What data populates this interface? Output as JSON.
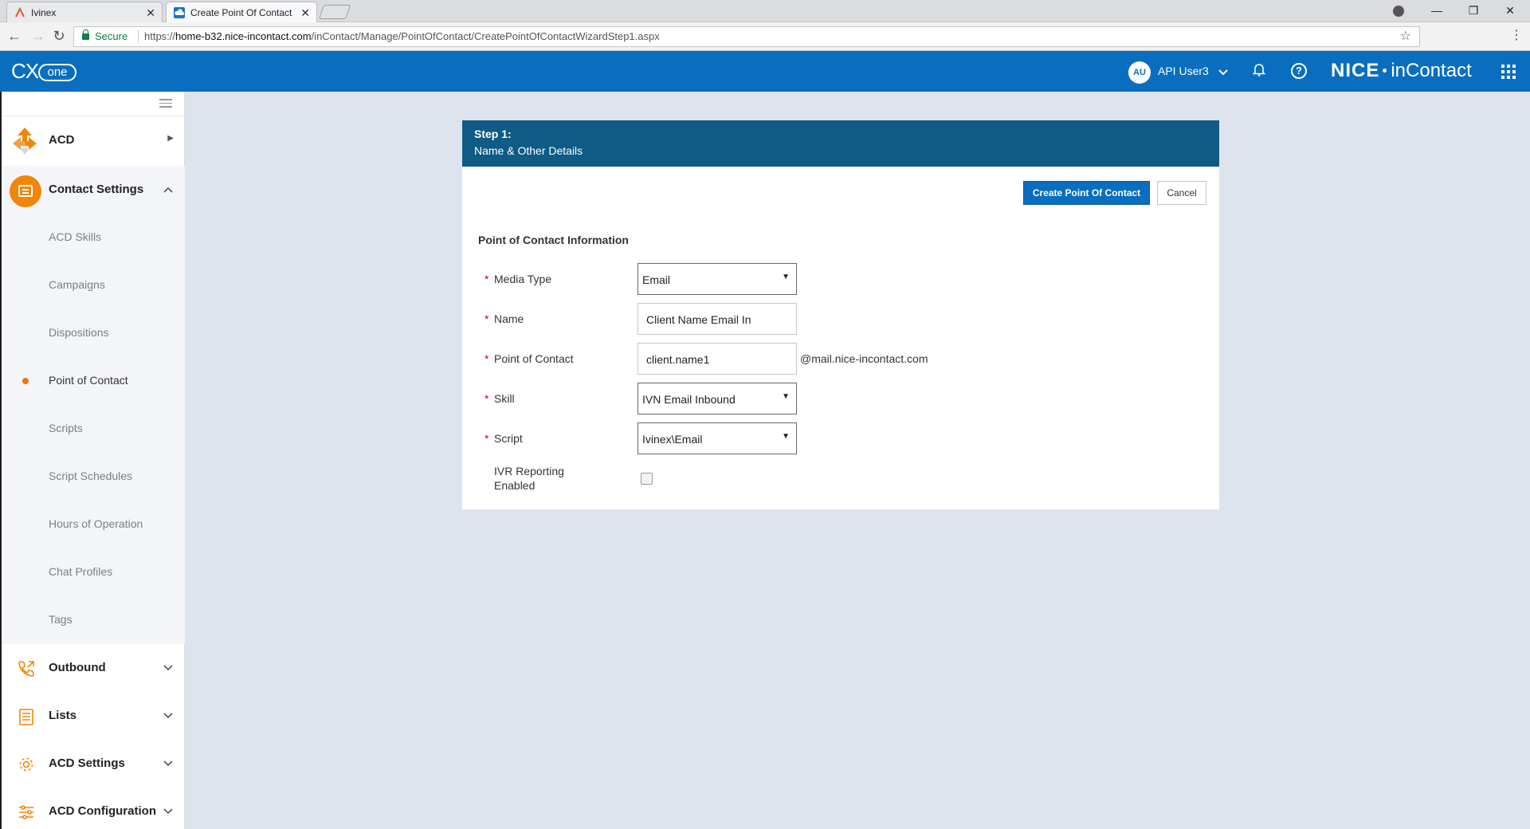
{
  "browser": {
    "tabs": [
      {
        "label": "Ivinex"
      },
      {
        "label": "Create Point Of Contact"
      }
    ],
    "secure_label": "Secure",
    "url_scheme": "https://",
    "url_host": "home-b32.nice-incontact.com",
    "url_path": "/inContact/Manage/PointOfContact/CreatePointOfContactWizardStep1.aspx"
  },
  "header": {
    "brand": "CX",
    "brand_suffix": "one",
    "avatar_initials": "AU",
    "username": "API User3",
    "nice_logo": "NICE",
    "incontact_logo": "inContact"
  },
  "sidebar": {
    "acd_label": "ACD",
    "contact_settings_label": "Contact Settings",
    "sub_items": [
      {
        "label": "ACD Skills"
      },
      {
        "label": "Campaigns"
      },
      {
        "label": "Dispositions"
      },
      {
        "label": "Point of Contact"
      },
      {
        "label": "Scripts"
      },
      {
        "label": "Script Schedules"
      },
      {
        "label": "Hours of Operation"
      },
      {
        "label": "Chat Profiles"
      },
      {
        "label": "Tags"
      }
    ],
    "outbound_label": "Outbound",
    "lists_label": "Lists",
    "acd_settings_label": "ACD Settings",
    "acd_configuration_label": "ACD Configuration"
  },
  "wizard": {
    "step_label": "Step 1:",
    "step_title": "Name & Other Details",
    "create_button": "Create Point Of Contact",
    "cancel_button": "Cancel",
    "section_title": "Point of Contact Information",
    "required_marker": "*",
    "fields": {
      "media_type": {
        "label": "Media Type",
        "value": "Email"
      },
      "name": {
        "label": "Name",
        "value": "Client Name Email In"
      },
      "point_of_contact": {
        "label": "Point of Contact",
        "value": "client.name1",
        "suffix": "@mail.nice-incontact.com"
      },
      "skill": {
        "label": "Skill",
        "value": "IVN Email Inbound"
      },
      "script": {
        "label": "Script",
        "value": "Ivinex\\Email"
      },
      "ivr_reporting": {
        "label": "IVR Reporting Enabled",
        "checked": false
      }
    }
  },
  "colors": {
    "brand_blue": "#0a6ec0",
    "panel_header": "#0e5b85",
    "accent_orange": "#f2860a",
    "required_red": "#d0021b"
  }
}
